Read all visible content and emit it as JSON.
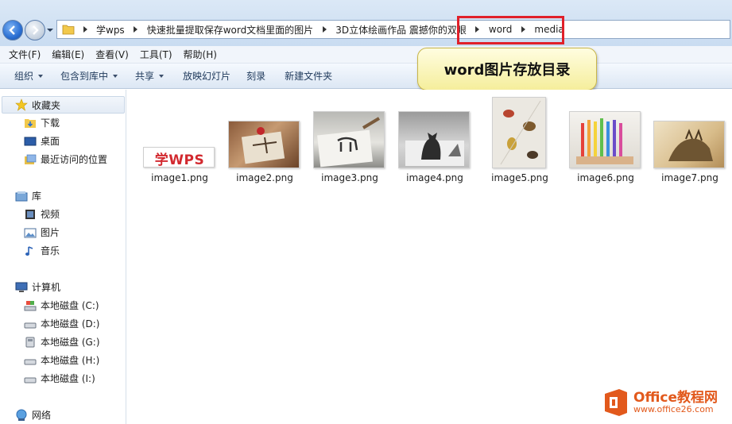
{
  "address_bar": {
    "crumbs": [
      "学wps",
      "快速批量提取保存word文档里面的图片",
      "3D立体绘画作品 震撼你的双眼",
      "word",
      "media"
    ]
  },
  "menu": [
    "文件(F)",
    "编辑(E)",
    "查看(V)",
    "工具(T)",
    "帮助(H)"
  ],
  "toolbar": {
    "organize": "组织",
    "include_in_library": "包含到库中",
    "share": "共享",
    "slideshow": "放映幻灯片",
    "burn": "刻录",
    "new_folder": "新建文件夹"
  },
  "callout": "word图片存放目录",
  "nav": {
    "favorites": "收藏夹",
    "downloads": "下载",
    "desktop": "桌面",
    "recent": "最近访问的位置",
    "libraries": "库",
    "videos": "视频",
    "pictures": "图片",
    "music": "音乐",
    "computer": "计算机",
    "drives": [
      "本地磁盘 (C:)",
      "本地磁盘 (D:)",
      "本地磁盘 (G:)",
      "本地磁盘 (H:)",
      "本地磁盘 (I:)"
    ],
    "network": "网络"
  },
  "files": [
    {
      "name": "image1.png",
      "logo_text": "学WPS"
    },
    {
      "name": "image2.png"
    },
    {
      "name": "image3.png"
    },
    {
      "name": "image4.png"
    },
    {
      "name": "image5.png"
    },
    {
      "name": "image6.png"
    },
    {
      "name": "image7.png"
    }
  ],
  "watermark": {
    "title": "Office教程网",
    "url": "www.office26.com"
  },
  "colors": {
    "highlight": "#e0202a",
    "callout_bg": "#f5ee9c",
    "watermark": "#e2591c"
  }
}
